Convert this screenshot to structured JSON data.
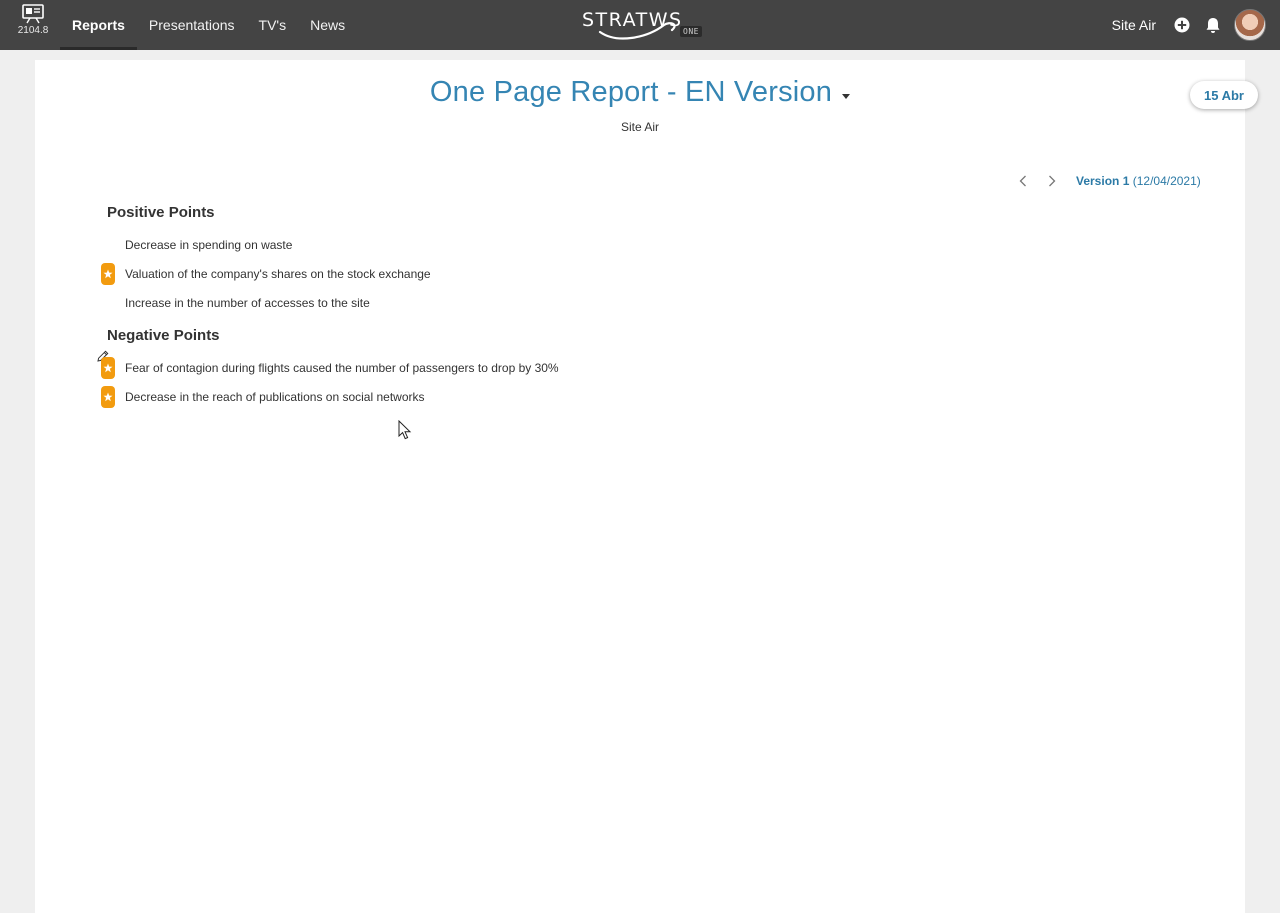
{
  "app": {
    "version": "2104.8",
    "brand": "STRATWS",
    "brand_suffix": "ONE"
  },
  "nav": {
    "items": [
      {
        "label": "Reports",
        "active": true
      },
      {
        "label": "Presentations",
        "active": false
      },
      {
        "label": "TV's",
        "active": false
      },
      {
        "label": "News",
        "active": false
      }
    ]
  },
  "header_right": {
    "site_name": "Site Air",
    "icons": [
      "plus-circle-icon",
      "bell-icon"
    ]
  },
  "report": {
    "title": "One Page Report - EN Version",
    "subtitle": "Site Air",
    "date_badge": "15 Abr",
    "version_label": "Version 1",
    "version_date": "(12/04/2021)"
  },
  "sections": [
    {
      "title": "Positive Points",
      "points": [
        {
          "text": "Decrease in spending on waste",
          "starred": false
        },
        {
          "text": "Valuation of the company's shares on the stock exchange",
          "starred": true
        },
        {
          "text": "Increase in the number of accesses to the site",
          "starred": false
        }
      ]
    },
    {
      "title": "Negative Points",
      "points": [
        {
          "text": "Fear of contagion during flights caused the number of passengers to drop by 30%",
          "starred": true
        },
        {
          "text": "Decrease in the reach of publications on social networks",
          "starred": true
        }
      ]
    }
  ],
  "colors": {
    "topbar": "#444444",
    "accent": "#3585b3",
    "star": "#f29b0f"
  }
}
